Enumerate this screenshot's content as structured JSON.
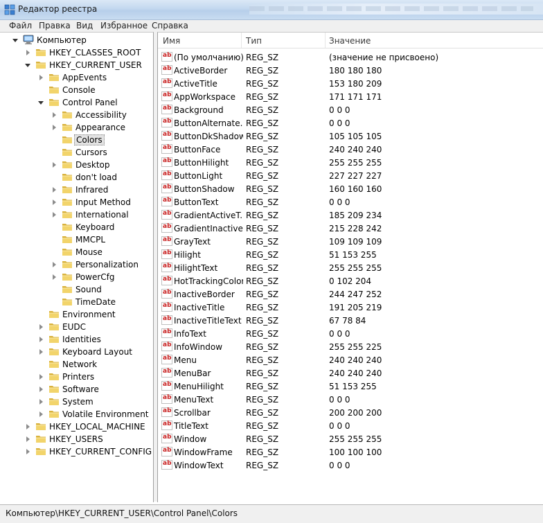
{
  "window": {
    "title": "Редактор реестра"
  },
  "menu": [
    "Файл",
    "Правка",
    "Вид",
    "Избранное",
    "Справка"
  ],
  "tree": [
    {
      "label": "Компьютер",
      "level": 0,
      "state": "open",
      "icon": "computer-icon"
    },
    {
      "label": "HKEY_CLASSES_ROOT",
      "level": 1,
      "state": "closed"
    },
    {
      "label": "HKEY_CURRENT_USER",
      "level": 1,
      "state": "open"
    },
    {
      "label": "AppEvents",
      "level": 2,
      "state": "closed"
    },
    {
      "label": "Console",
      "level": 2,
      "state": "none"
    },
    {
      "label": "Control Panel",
      "level": 2,
      "state": "open"
    },
    {
      "label": "Accessibility",
      "level": 3,
      "state": "closed"
    },
    {
      "label": "Appearance",
      "level": 3,
      "state": "closed"
    },
    {
      "label": "Colors",
      "level": 3,
      "state": "none",
      "selected": true
    },
    {
      "label": "Cursors",
      "level": 3,
      "state": "none"
    },
    {
      "label": "Desktop",
      "level": 3,
      "state": "closed"
    },
    {
      "label": "don't load",
      "level": 3,
      "state": "none"
    },
    {
      "label": "Infrared",
      "level": 3,
      "state": "closed"
    },
    {
      "label": "Input Method",
      "level": 3,
      "state": "closed"
    },
    {
      "label": "International",
      "level": 3,
      "state": "closed"
    },
    {
      "label": "Keyboard",
      "level": 3,
      "state": "none"
    },
    {
      "label": "MMCPL",
      "level": 3,
      "state": "none"
    },
    {
      "label": "Mouse",
      "level": 3,
      "state": "none"
    },
    {
      "label": "Personalization",
      "level": 3,
      "state": "closed"
    },
    {
      "label": "PowerCfg",
      "level": 3,
      "state": "closed"
    },
    {
      "label": "Sound",
      "level": 3,
      "state": "none"
    },
    {
      "label": "TimeDate",
      "level": 3,
      "state": "none"
    },
    {
      "label": "Environment",
      "level": 2,
      "state": "none"
    },
    {
      "label": "EUDC",
      "level": 2,
      "state": "closed"
    },
    {
      "label": "Identities",
      "level": 2,
      "state": "closed"
    },
    {
      "label": "Keyboard Layout",
      "level": 2,
      "state": "closed"
    },
    {
      "label": "Network",
      "level": 2,
      "state": "none"
    },
    {
      "label": "Printers",
      "level": 2,
      "state": "closed"
    },
    {
      "label": "Software",
      "level": 2,
      "state": "closed"
    },
    {
      "label": "System",
      "level": 2,
      "state": "closed"
    },
    {
      "label": "Volatile Environment",
      "level": 2,
      "state": "closed"
    },
    {
      "label": "HKEY_LOCAL_MACHINE",
      "level": 1,
      "state": "closed"
    },
    {
      "label": "HKEY_USERS",
      "level": 1,
      "state": "closed"
    },
    {
      "label": "HKEY_CURRENT_CONFIG",
      "level": 1,
      "state": "closed"
    }
  ],
  "columns": {
    "name": "Имя",
    "type": "Тип",
    "data": "Значение"
  },
  "values": [
    {
      "name": "(По умолчанию)",
      "type": "REG_SZ",
      "data": "(значение не присвоено)"
    },
    {
      "name": "ActiveBorder",
      "type": "REG_SZ",
      "data": "180 180 180"
    },
    {
      "name": "ActiveTitle",
      "type": "REG_SZ",
      "data": "153 180 209"
    },
    {
      "name": "AppWorkspace",
      "type": "REG_SZ",
      "data": "171 171 171"
    },
    {
      "name": "Background",
      "type": "REG_SZ",
      "data": "0 0 0"
    },
    {
      "name": "ButtonAlternate...",
      "type": "REG_SZ",
      "data": "0 0 0"
    },
    {
      "name": "ButtonDkShadow",
      "type": "REG_SZ",
      "data": "105 105 105"
    },
    {
      "name": "ButtonFace",
      "type": "REG_SZ",
      "data": "240 240 240"
    },
    {
      "name": "ButtonHilight",
      "type": "REG_SZ",
      "data": "255 255 255"
    },
    {
      "name": "ButtonLight",
      "type": "REG_SZ",
      "data": "227 227 227"
    },
    {
      "name": "ButtonShadow",
      "type": "REG_SZ",
      "data": "160 160 160"
    },
    {
      "name": "ButtonText",
      "type": "REG_SZ",
      "data": "0 0 0"
    },
    {
      "name": "GradientActiveT...",
      "type": "REG_SZ",
      "data": "185 209 234"
    },
    {
      "name": "GradientInactive...",
      "type": "REG_SZ",
      "data": "215 228 242"
    },
    {
      "name": "GrayText",
      "type": "REG_SZ",
      "data": "109 109 109"
    },
    {
      "name": "Hilight",
      "type": "REG_SZ",
      "data": "51 153 255"
    },
    {
      "name": "HilightText",
      "type": "REG_SZ",
      "data": "255 255 255"
    },
    {
      "name": "HotTrackingColor",
      "type": "REG_SZ",
      "data": "0 102 204"
    },
    {
      "name": "InactiveBorder",
      "type": "REG_SZ",
      "data": "244 247 252"
    },
    {
      "name": "InactiveTitle",
      "type": "REG_SZ",
      "data": "191 205 219"
    },
    {
      "name": "InactiveTitleText",
      "type": "REG_SZ",
      "data": "67 78 84"
    },
    {
      "name": "InfoText",
      "type": "REG_SZ",
      "data": "0 0 0"
    },
    {
      "name": "InfoWindow",
      "type": "REG_SZ",
      "data": "255 255 225"
    },
    {
      "name": "Menu",
      "type": "REG_SZ",
      "data": "240 240 240"
    },
    {
      "name": "MenuBar",
      "type": "REG_SZ",
      "data": "240 240 240"
    },
    {
      "name": "MenuHilight",
      "type": "REG_SZ",
      "data": "51 153 255"
    },
    {
      "name": "MenuText",
      "type": "REG_SZ",
      "data": "0 0 0"
    },
    {
      "name": "Scrollbar",
      "type": "REG_SZ",
      "data": "200 200 200"
    },
    {
      "name": "TitleText",
      "type": "REG_SZ",
      "data": "0 0 0"
    },
    {
      "name": "Window",
      "type": "REG_SZ",
      "data": "255 255 255"
    },
    {
      "name": "WindowFrame",
      "type": "REG_SZ",
      "data": "100 100 100"
    },
    {
      "name": "WindowText",
      "type": "REG_SZ",
      "data": "0 0 0"
    }
  ],
  "status": {
    "path": "Компьютер\\HKEY_CURRENT_USER\\Control Panel\\Colors"
  },
  "colors": {
    "folder": "#f2d46b",
    "folder_dark": "#d9b23c",
    "value_icon_red": "#c81e1e"
  }
}
